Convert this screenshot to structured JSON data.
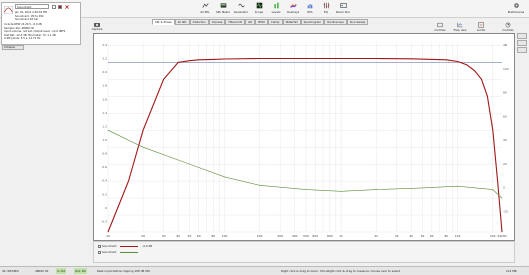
{
  "toolbar": {
    "items": [
      {
        "label": "Measure",
        "icon": "measure-icon"
      },
      {
        "label": "Open",
        "icon": "folder-icon"
      },
      {
        "label": "Save All",
        "icon": "save-all-icon"
      },
      {
        "label": "Remove All",
        "icon": "remove-all-icon"
      },
      {
        "label": "Info",
        "icon": "info-icon"
      },
      {
        "label": "All SPL",
        "icon": "all-spl-icon"
      },
      {
        "label": "Prefs",
        "icon": "prefs-icon"
      },
      {
        "label": "Help",
        "icon": "help-icon"
      }
    ],
    "center_items": [
      {
        "label": "All SPL",
        "icon": "all-spl-icon"
      },
      {
        "label": "SPL Meter",
        "icon": "spl-meter-icon"
      },
      {
        "label": "Generator",
        "icon": "generator-icon"
      },
      {
        "label": "Scope",
        "icon": "scope-icon"
      },
      {
        "label": "Levels",
        "icon": "levels-icon"
      },
      {
        "label": "Overlays",
        "icon": "overlays-icon"
      },
      {
        "label": "RTA",
        "icon": "rta-icon"
      },
      {
        "label": "EQ",
        "icon": "eq-icon"
      },
      {
        "label": "Room Sim",
        "icon": "room-sim-icon"
      }
    ],
    "preferences": {
      "label": "Preferences",
      "icon": "gear-icon"
    }
  },
  "measurement": {
    "name": "Soundcard",
    "date": "Jan 29, 2021 2:46:16 PM",
    "l1": "Soundcard, 1M to 48k",
    "l2": "Soundcard 48 Cal",
    "info1": "Include REW v5.20.5, -0.0 dB",
    "info2": "Sample rate: 48000 Hz",
    "info3": "Input volume: not set, Output level: -12.0 dBFS",
    "info4": "Dist Ref. -12.0 dB, Mic/meter: Hi -1.1 dB",
    "info5": "4.4M points, 5.5 s, 13.73 Hz",
    "collapse_label": "Collapse"
  },
  "capture": {
    "label": "Capture",
    "icon": "camera-icon"
  },
  "tabs": [
    "SPL & Phase",
    "All SPL",
    "Distortion",
    "Impulse",
    "Filtered IR",
    "GD",
    "RT60",
    "Clarity",
    "Waterfall",
    "Spectrogram",
    "Oscilloscope",
    "Sine Sweep"
  ],
  "active_tab": 0,
  "right_tools": [
    {
      "label": "Controls",
      "icon": "controls-icon"
    },
    {
      "label": "Freq. axis",
      "icon": "freq-axis-icon"
    },
    {
      "label": "Limits",
      "icon": "limits-icon"
    },
    {
      "label": "Controls",
      "icon": "controls2-icon"
    }
  ],
  "chart_data": {
    "type": "line",
    "x_scale": "log",
    "xlim": [
      10,
      24000
    ],
    "ylim": [
      -20,
      2.4
    ],
    "y_right_label": "dB",
    "x_tick_labels": [
      "10",
      "20",
      "30",
      "40",
      "50",
      "60",
      "80",
      "100",
      "200",
      "300",
      "400",
      "500",
      "600",
      "800",
      "1k",
      "2k",
      "3k",
      "4k",
      "5k",
      "6k",
      "8k",
      "10k",
      "20k",
      "24kHz"
    ],
    "y_left_ticks": [
      "2.4",
      "2.2",
      "2.0",
      "1.8",
      "1.6",
      "1.4",
      "1.2",
      "1.0",
      "0.8",
      "0.6",
      "0.4",
      "0.2",
      "0",
      "-0.2"
    ],
    "y_right_ticks": [
      "dB",
      "100",
      "80",
      "60",
      "40",
      "20",
      "0",
      "-20"
    ],
    "series": [
      {
        "name": "Soundcard",
        "color": "#a01818",
        "x": [
          10,
          15,
          20,
          30,
          40,
          50,
          60,
          80,
          100,
          200,
          400,
          1000,
          2000,
          4000,
          8000,
          10000,
          12000,
          14000,
          16000,
          18000,
          20000,
          22000,
          24000
        ],
        "y": [
          -20,
          -14,
          -8,
          -2,
          0,
          0.2,
          0.3,
          0.35,
          0.4,
          0.45,
          0.45,
          0.45,
          0.45,
          0.42,
          0.3,
          0.1,
          -0.3,
          -1,
          -2,
          -4,
          -8,
          -14,
          -20
        ]
      },
      {
        "name": "Soundcard",
        "color": "#5c8f3c",
        "x": [
          10,
          20,
          50,
          100,
          200,
          500,
          1000,
          2000,
          5000,
          10000,
          20000,
          24000
        ],
        "y": [
          -8,
          -10,
          -12,
          -13.5,
          -14.5,
          -15,
          -15.2,
          -15,
          -14.8,
          -14.6,
          -15,
          -16
        ]
      }
    ]
  },
  "legend": {
    "entries": [
      {
        "name": "Soundcard",
        "value": "-0.0 dB",
        "color": "#a01818"
      },
      {
        "name": "Soundcard",
        "value": "",
        "color": "#5c8f3c"
      }
    ]
  },
  "status": {
    "s1": "44 (28/SMS)",
    "s2": "48000 Hz",
    "s3": "In: RX",
    "s4": "Out: RX",
    "s5": "Peak input before clipping 108 dB SPL",
    "s6": "Right click & drag to zoom, Ctrl+Right click & drag to measure; mouse over to select",
    "s7": "114 MB"
  }
}
